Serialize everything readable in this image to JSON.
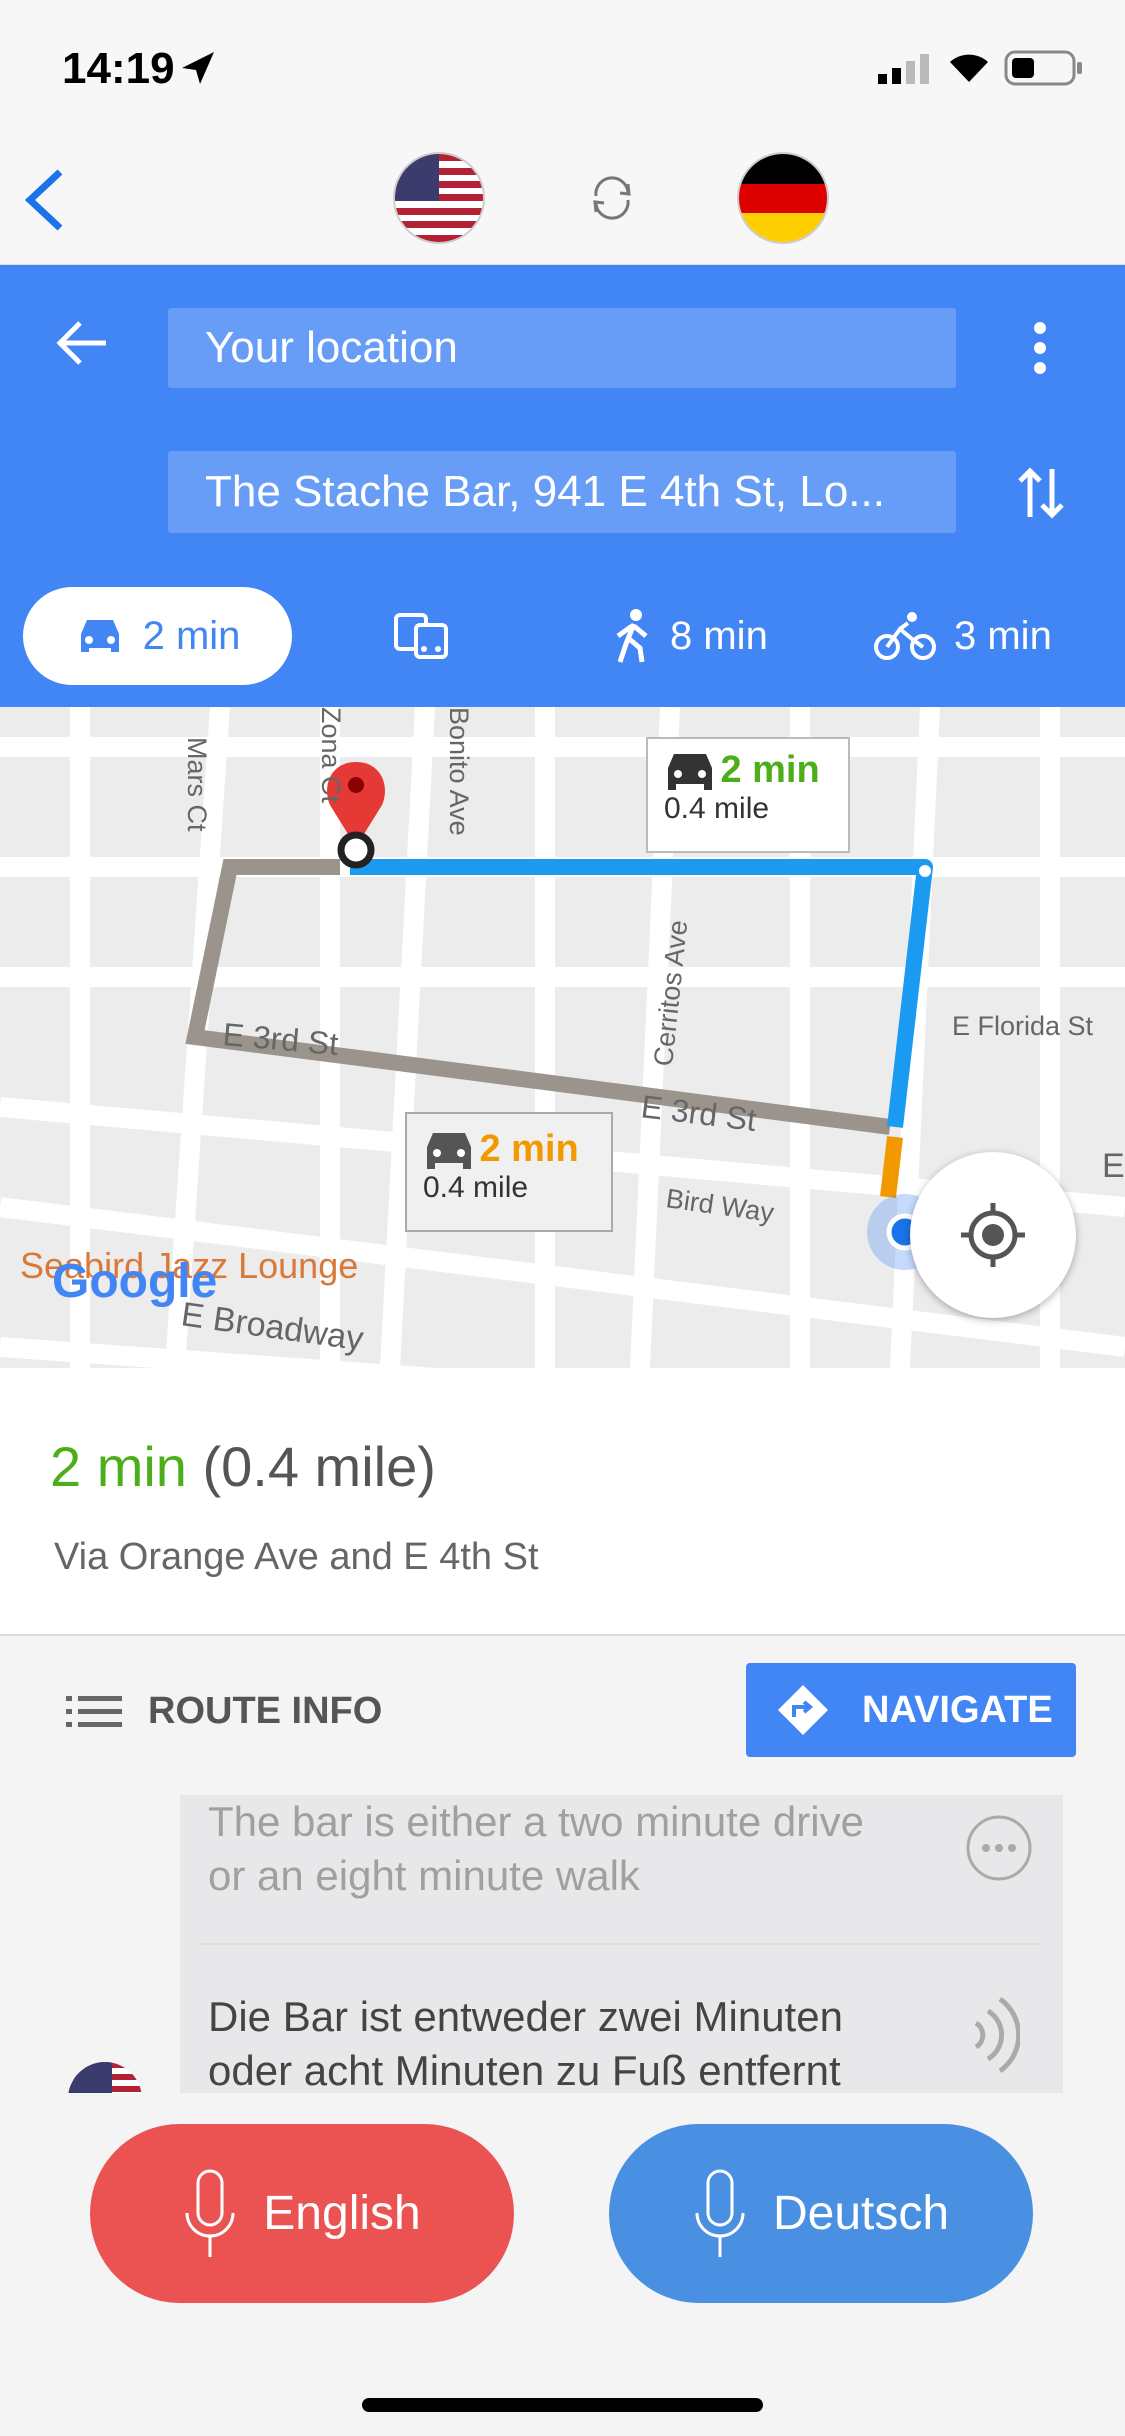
{
  "status": {
    "time": "14:19"
  },
  "header": {
    "source_flag": "us-flag",
    "target_flag": "germany-flag"
  },
  "directions": {
    "origin": "Your location",
    "destination": "The Stache Bar, 941 E 4th St, Lo...",
    "modes": [
      {
        "icon": "car-icon",
        "label": "2 min",
        "selected": true
      },
      {
        "icon": "transit-icon",
        "label": ""
      },
      {
        "icon": "walk-icon",
        "label": "8 min"
      },
      {
        "icon": "bike-icon",
        "label": "3 min"
      }
    ]
  },
  "map": {
    "streets": [
      "Mars Ct",
      "Zona Ct",
      "Bonito Ave",
      "Cerritos Ave",
      "E Florida St",
      "E 3rd St",
      "E 3rd St",
      "Bird Way",
      "Seabird Jazz Lounge",
      "E Broadway",
      "E"
    ],
    "callout_primary": {
      "time": "2 min",
      "distance": "0.4 mile",
      "color": "#4caf1a"
    },
    "callout_alt": {
      "time": "2 min",
      "distance": "0.4 mile",
      "color": "#f29900"
    },
    "logo": "Google"
  },
  "summary": {
    "time": "2 min",
    "distance": "(0.4 mile)",
    "via": "Via Orange Ave and E 4th St"
  },
  "actions": {
    "route_info": "ROUTE INFO",
    "navigate": "NAVIGATE"
  },
  "conversation": {
    "source_text": "The bar is either a two minute drive or an eight minute walk",
    "translated_text": "Die Bar ist entweder zwei Minuten oder acht Minuten zu Fuß entfernt"
  },
  "mic_buttons": {
    "english": "English",
    "deutsch": "Deutsch",
    "english_color": "#eb5353",
    "deutsch_color": "#4a90e2"
  }
}
